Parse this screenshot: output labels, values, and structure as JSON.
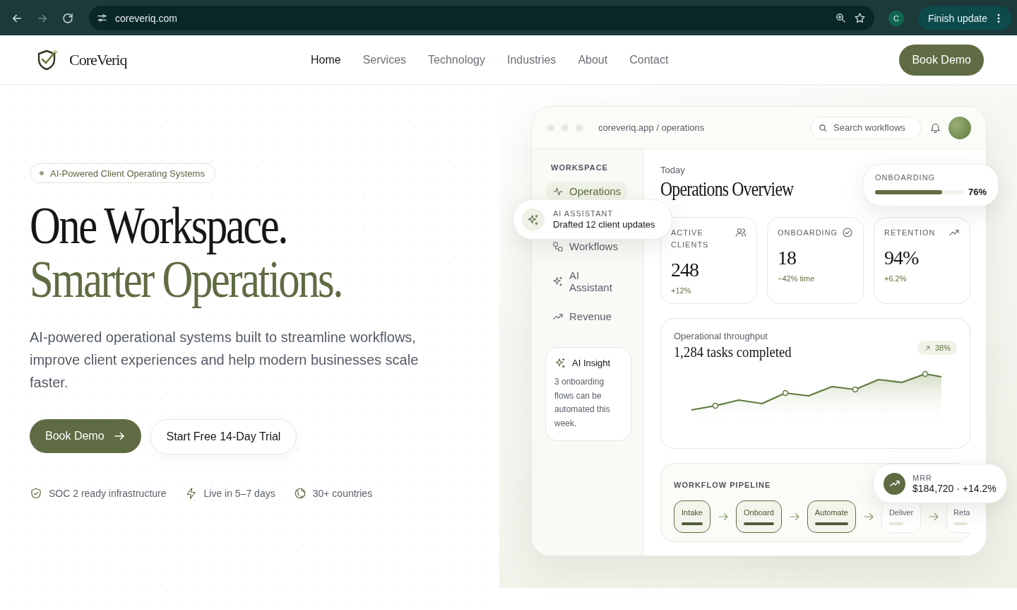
{
  "browser": {
    "url": "coreveriq.com",
    "avatar": "C",
    "update_button": "Finish update"
  },
  "nav": {
    "brand": "CoreVeriq",
    "links": [
      {
        "label": "Home",
        "selected": true
      },
      {
        "label": "Services",
        "selected": false
      },
      {
        "label": "Technology",
        "selected": false
      },
      {
        "label": "Industries",
        "selected": false
      },
      {
        "label": "About",
        "selected": false
      },
      {
        "label": "Contact",
        "selected": false
      }
    ],
    "cta": "Book Demo"
  },
  "hero": {
    "badge": "AI-Powered Client Operating Systems",
    "title_line_1": "One Workspace.",
    "title_line_2": "Smarter Operations.",
    "description": "AI-powered operational systems built to streamline workflows, improve client experiences and help modern businesses scale faster.",
    "primary_button": "Book Demo",
    "secondary_button": "Start Free 14-Day Trial",
    "features": [
      {
        "kind": "shield",
        "label": "SOC 2 ready infrastructure"
      },
      {
        "kind": "bolt",
        "label": "Live in 5–7 days"
      },
      {
        "kind": "globe",
        "label": "30+ countries"
      }
    ]
  },
  "dashboard": {
    "address": "coreveriq.app / operations",
    "search_placeholder": "Search workflows",
    "sidebar": {
      "heading": "WORKSPACE",
      "items": [
        {
          "kind": "pulse",
          "label": "Operations",
          "selected": true
        },
        {
          "kind": "workflow",
          "label": "Workflows",
          "selected": false
        },
        {
          "kind": "sparkle",
          "label": "AI Assistant",
          "selected": false
        },
        {
          "kind": "trend",
          "label": "Revenue",
          "selected": false
        }
      ]
    },
    "insight": {
      "title": "AI Insight",
      "text": "3 onboarding flows can be automated this week."
    },
    "eyebrow": "Today",
    "title": "Operations Overview",
    "stats": [
      {
        "kind": "users",
        "label": "ACTIVE CLIENTS",
        "value": "248",
        "change": "+12%"
      },
      {
        "kind": "check",
        "label": "ONBOARDING",
        "value": "18",
        "change": "−42% time"
      },
      {
        "kind": "trend",
        "label": "RETENTION",
        "value": "94%",
        "change": "+6.2%"
      }
    ],
    "throughput": {
      "label": "Operational throughput",
      "value": "1,284 tasks completed",
      "badge": "38%"
    },
    "pipeline": {
      "heading": "WORKFLOW PIPELINE",
      "stages": [
        {
          "label": "Intake",
          "active": true
        },
        {
          "label": "Onboard",
          "active": true
        },
        {
          "label": "Automate",
          "active": true
        },
        {
          "label": "Deliver",
          "active": false
        },
        {
          "label": "Reta",
          "active": false
        }
      ]
    }
  },
  "overlays": {
    "assistant": {
      "label": "AI ASSISTANT",
      "text": "Drafted 12 client updates"
    },
    "onboarding": {
      "label": "ONBOARDING",
      "level": 0.76,
      "reading": "76%"
    },
    "mrr": {
      "label": "MRR",
      "value": "$184,720 · +14.2%"
    }
  }
}
